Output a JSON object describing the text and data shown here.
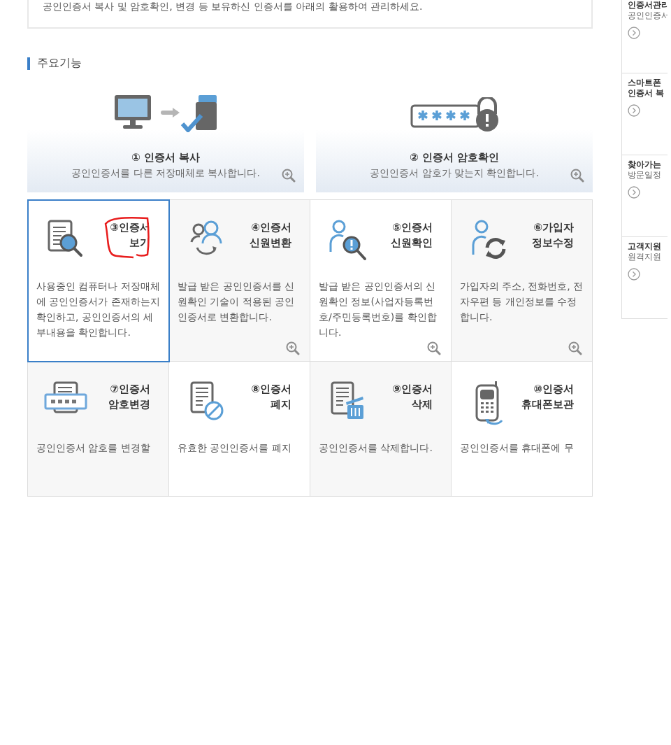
{
  "intro": {
    "text": "공인인증서 복사 및 암호확인, 변경 등 보유하신 인증서를 아래의 활용하여 관리하세요."
  },
  "section": {
    "title": "주요기능"
  },
  "top_features": [
    {
      "kind": "copy",
      "title": "① 인증서 복사",
      "description": "공인인증서를 다른 저장매체로 복사합니다."
    },
    {
      "kind": "password_check",
      "title": "② 인증서 암호확인",
      "description": "공인인증서 암호가 맞는지 확인합니다."
    }
  ],
  "features": [
    {
      "kind": "view",
      "title_lines": [
        "③인증서",
        "보기"
      ],
      "description": "사용중인 컴퓨터나 저장매체에 공인인증서가 존재하는지 확인하고, 공인인증서의 세부내용을 확인합니다.",
      "selected": true,
      "annotated": true,
      "zoom_button": false
    },
    {
      "kind": "convert",
      "title_lines": [
        "④인증서",
        "신원변환"
      ],
      "description": "발급 받은 공인인증서를 신원확인 기술이 적용된 공인인증서로 변환합니다.",
      "selected": false,
      "annotated": false,
      "zoom_button": true
    },
    {
      "kind": "verify",
      "title_lines": [
        "⑤인증서",
        "신원확인"
      ],
      "description": "발급 받은 공인인증서의 신원확인 정보(사업자등록번호/주민등록번호)를 확인합니다.",
      "selected": false,
      "annotated": false,
      "zoom_button": true
    },
    {
      "kind": "update",
      "title_lines": [
        "⑥가입자",
        "정보수정"
      ],
      "description": "가입자의 주소, 전화번호, 전자우편 등 개인정보를 수정합니다.",
      "selected": false,
      "annotated": false,
      "zoom_button": true
    },
    {
      "kind": "password",
      "title_lines": [
        "⑦인증서",
        "암호변경"
      ],
      "description": "공인인증서 암호를 변경할",
      "selected": false,
      "annotated": false,
      "zoom_button": false
    },
    {
      "kind": "revoke",
      "title_lines": [
        "⑧인증서",
        "폐지"
      ],
      "description": "유효한 공인인증서를 폐지",
      "selected": false,
      "annotated": false,
      "zoom_button": false
    },
    {
      "kind": "delete",
      "title_lines": [
        "⑨인증서",
        "삭제"
      ],
      "description": "공인인증서를 삭제합니다.",
      "selected": false,
      "annotated": false,
      "zoom_button": false
    },
    {
      "kind": "phone",
      "title_lines": [
        "⑩인증서",
        "휴대폰보관"
      ],
      "description": "공인인증서를 휴대폰에 무",
      "selected": false,
      "annotated": false,
      "zoom_button": false
    }
  ],
  "sidebar": {
    "items": [
      {
        "title": "인증서관리",
        "subtitle": "공인인증서"
      },
      {
        "title": "스마트폰\n인증서 복"
      },
      {
        "title": "찾아가는",
        "subtitle": "방문일정"
      },
      {
        "title": "고객지원",
        "subtitle": "원격지원"
      }
    ]
  }
}
